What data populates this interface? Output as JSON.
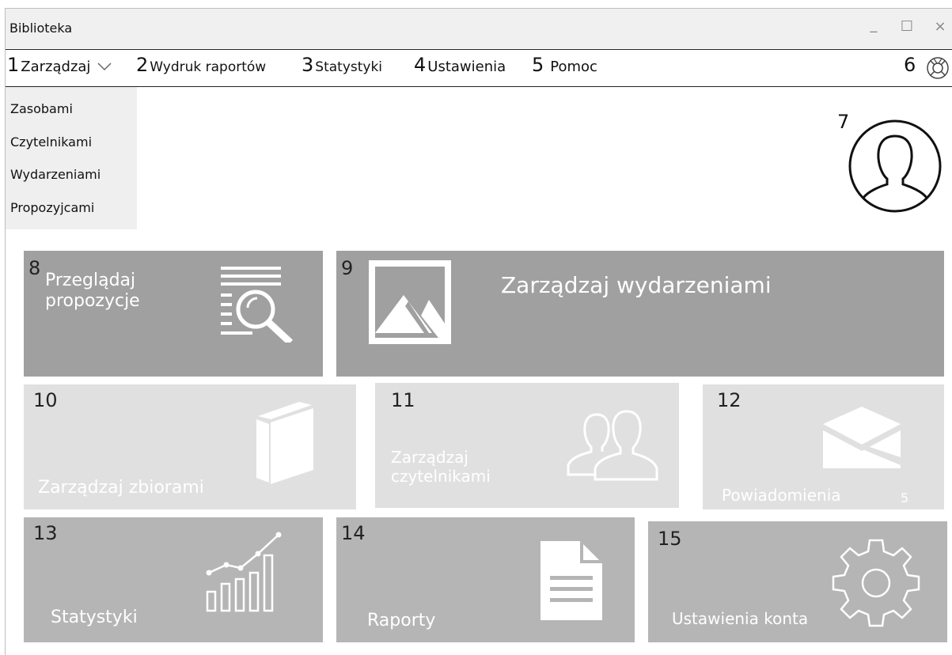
{
  "window": {
    "title": "Biblioteka",
    "controls": {
      "minimize": "_",
      "maximize": "☐",
      "close": "×"
    }
  },
  "menu": {
    "items": [
      {
        "num": "1",
        "label": "Zarządzaj"
      },
      {
        "num": "2",
        "label": "Wydruk raportów"
      },
      {
        "num": "3",
        "label": "Statystyki"
      },
      {
        "num": "4",
        "label": "Ustawienia"
      },
      {
        "num": "5",
        "label": "Pomoc"
      }
    ],
    "help_num": "6",
    "help_icon": "lifebuoy-icon"
  },
  "dropdown": {
    "items": [
      "Zasobami",
      "Czytelnikami",
      "Wydarzeniami",
      "Propozyjcami"
    ]
  },
  "avatar": {
    "num": "7",
    "icon": "user-avatar-icon"
  },
  "tiles": {
    "propozycje": {
      "num": "8",
      "label_line1": "Przeglądaj",
      "label_line2": "propozycje",
      "icon": "document-search-icon"
    },
    "wydarzenia": {
      "num": "9",
      "label": "Zarządzaj wydarzeniami",
      "icon": "image-icon"
    },
    "zbiory": {
      "num": "10",
      "label": "Zarządzaj zbiorami",
      "icon": "book-icon"
    },
    "czytelnicy": {
      "num": "11",
      "label_line1": "Zarządzaj",
      "label_line2": "czytelnikami",
      "icon": "users-icon"
    },
    "powiadomienia": {
      "num": "12",
      "label": "Powiadomienia",
      "count": "5",
      "icon": "envelope-icon"
    },
    "statystyki": {
      "num": "13",
      "label": "Statystyki",
      "icon": "chart-icon"
    },
    "raporty": {
      "num": "14",
      "label": "Raporty",
      "icon": "report-document-icon"
    },
    "ustawienia": {
      "num": "15",
      "label": "Ustawienia konta",
      "icon": "gear-icon"
    }
  },
  "colors": {
    "tile_dark": "#a0a0a0",
    "tile_light": "#e0e0e0",
    "tile_mid": "#b5b5b5",
    "titlebar": "#f0f0f0"
  }
}
